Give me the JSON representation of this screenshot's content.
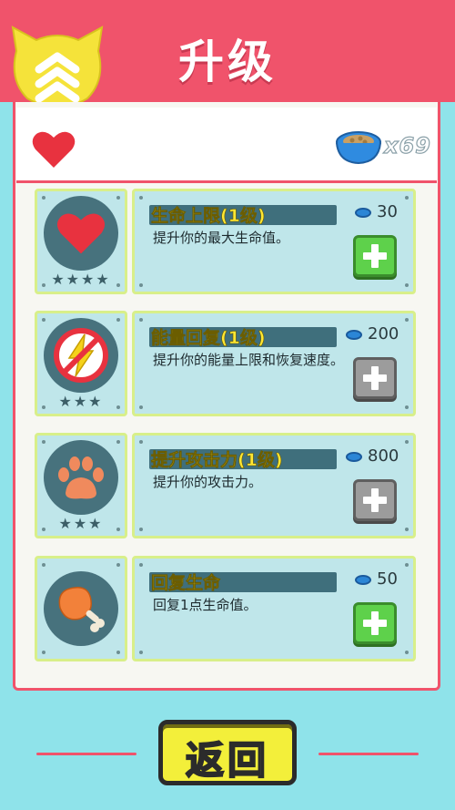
{
  "header": {
    "title": "升级"
  },
  "topbar": {
    "coin_count": "x69"
  },
  "items": [
    {
      "title": "生命上限(1级)",
      "desc": "提升你的最大生命值。",
      "cost": "30",
      "stars": "★★★★",
      "icon": "heart-icon",
      "button_state": "enabled"
    },
    {
      "title": "能量回复(1级)",
      "desc": "提升你的能量上限和恢复速度。",
      "cost": "200",
      "stars": "★★★",
      "icon": "lightning-icon",
      "button_state": "disabled"
    },
    {
      "title": "提升攻击力(1级)",
      "desc": "提升你的攻击力。",
      "cost": "800",
      "stars": "★★★",
      "icon": "paw-icon",
      "button_state": "disabled"
    },
    {
      "title": "回复生命",
      "desc": "回复1点生命值。",
      "cost": "50",
      "stars": "",
      "icon": "drumstick-icon",
      "button_state": "enabled"
    }
  ],
  "footer": {
    "return_label": "返回"
  },
  "colors": {
    "accent": "#f0536b",
    "background": "#8fe3ea",
    "title_yellow": "#ffe733",
    "button_green": "#5ed14b"
  }
}
